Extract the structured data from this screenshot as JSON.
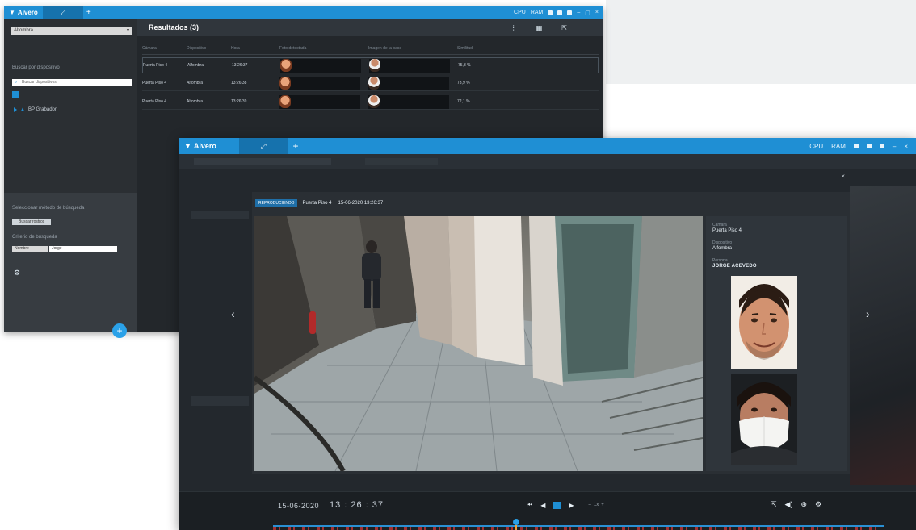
{
  "back_window": {
    "app_name": "Aivero",
    "filter_select": "Alfombra",
    "left_label": "Buscar por dispositivo",
    "search_placeholder": "Buscar dispositivos",
    "tree_item": "BP Grabador",
    "lower_label": "Seleccionar método de búsqueda",
    "checkbox_label": "Buscar rostros",
    "criteria_label": "Criterio de búsqueda",
    "mini_select": "Nombre",
    "mini_value": "Jorge",
    "results_title": "Resultados (3)",
    "columns": [
      "Cámara",
      "Dispositivo",
      "Hora",
      "Foto detectada",
      "Imagen de la base",
      "Similitud"
    ],
    "rows": [
      {
        "camera": "Puerta Piso 4",
        "device": "Alfombra",
        "time": "13:26:37",
        "similarity": "75,3 %"
      },
      {
        "camera": "Puerta Piso 4",
        "device": "Alfombra",
        "time": "13:26:38",
        "similarity": "73,9 %"
      },
      {
        "camera": "Puerta Piso 4",
        "device": "Alfombra",
        "time": "13:26:39",
        "similarity": "72,1 %"
      }
    ],
    "status_cpu": "CPU",
    "status_ram": "RAM",
    "fab_label": "+"
  },
  "front_window": {
    "app_name": "Aivero",
    "status_cpu": "CPU",
    "status_ram": "RAM",
    "modal": {
      "badge": "REPRODUCIENDO",
      "camera": "Puerta Piso 4",
      "timestamp": "15-06-2020 13:26:37",
      "close": "×"
    },
    "side_panel": {
      "camera_label": "Cámara",
      "camera_value": "Puerta Piso 4",
      "device_label": "Dispositivo",
      "device_value": "Alfombra",
      "person_label": "Persona",
      "person_name": "JORGE ACEVEDO"
    },
    "playback": {
      "date": "15-06-2020",
      "time": "13 : 26 : 37",
      "speed": "1x",
      "prev_arrow": "‹",
      "next_arrow": "›"
    }
  }
}
